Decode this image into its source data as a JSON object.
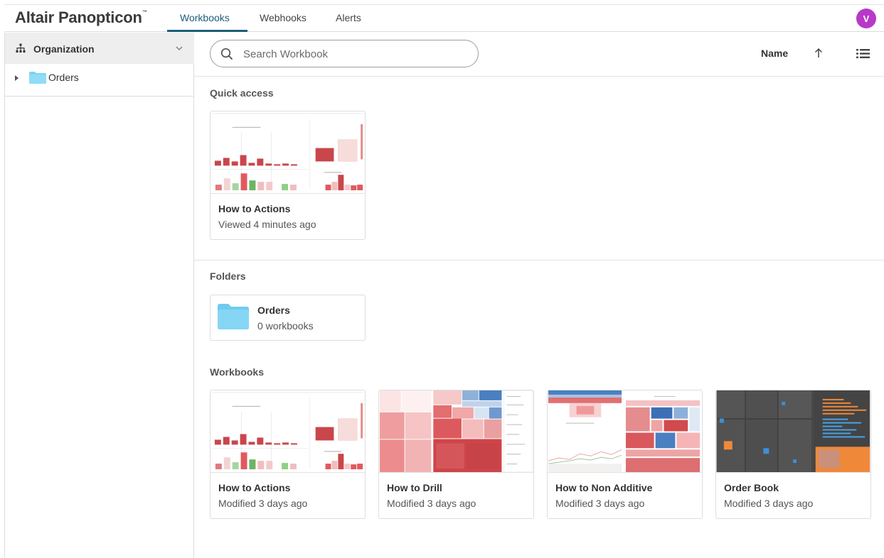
{
  "app": {
    "title": "Altair Panopticon",
    "trademark": "™"
  },
  "nav": {
    "tabs": [
      "Workbooks",
      "Webhooks",
      "Alerts"
    ],
    "active_tab": "Workbooks"
  },
  "user": {
    "avatar_initial": "V",
    "avatar_color": "#b839c8"
  },
  "sidebar": {
    "header_label": "Organization",
    "tree": [
      {
        "label": "Orders",
        "icon": "folder-icon"
      }
    ]
  },
  "search": {
    "placeholder": "Search Workbook",
    "value": ""
  },
  "sort": {
    "field": "Name",
    "direction_icon": "arrow-up-icon"
  },
  "view_toggle_icon": "list-view-icon",
  "quick_access": {
    "title": "Quick access",
    "items": [
      {
        "title": "How to Actions",
        "subtitle": "Viewed 4 minutes ago"
      }
    ]
  },
  "folders": {
    "title": "Folders",
    "items": [
      {
        "name": "Orders",
        "count": "0 workbooks"
      }
    ]
  },
  "workbooks": {
    "title": "Workbooks",
    "items": [
      {
        "title": "How to Actions",
        "subtitle": "Modified 3 days ago"
      },
      {
        "title": "How to Drill",
        "subtitle": "Modified 3 days ago"
      },
      {
        "title": "How to Non Additive",
        "subtitle": "Modified 3 days ago"
      },
      {
        "title": "Order Book",
        "subtitle": "Modified 3 days ago"
      }
    ]
  },
  "colors": {
    "accent": "#1c5d7a",
    "folder": "#7dd3f2",
    "thumb_red": "#c9464b"
  }
}
